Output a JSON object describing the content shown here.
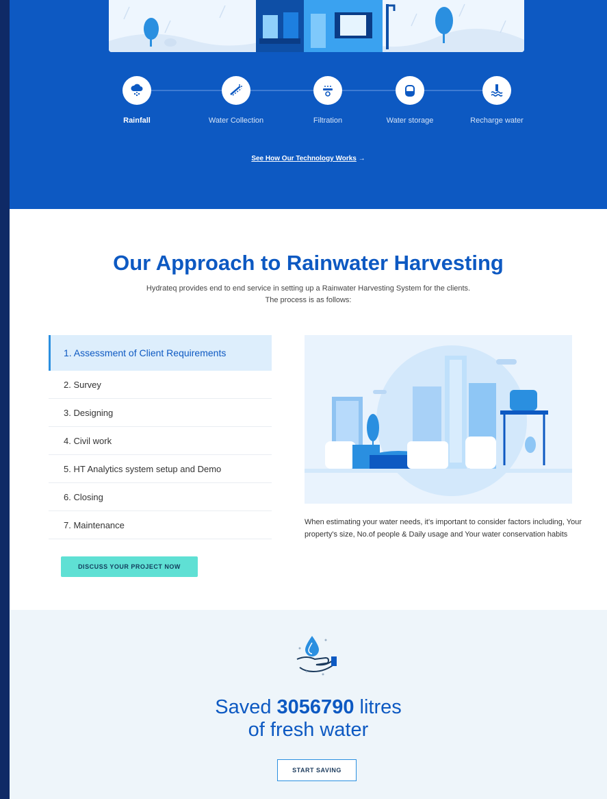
{
  "hero": {
    "steps": [
      {
        "label": "Rainfall",
        "icon": "cloud-rain-icon"
      },
      {
        "label": "Water Collection",
        "icon": "roof-icon"
      },
      {
        "label": "Filtration",
        "icon": "filter-icon"
      },
      {
        "label": "Water storage",
        "icon": "tank-icon"
      },
      {
        "label": "Recharge water",
        "icon": "recharge-icon"
      }
    ],
    "tech_link": "See How Our Technology Works",
    "tech_arrow": "→"
  },
  "approach": {
    "title": "Our Approach to Rainwater Harvesting",
    "subtitle": "Hydrateq provides end to end service in setting up a Rainwater Harvesting System for the clients.  The process is as follows:",
    "steps": [
      "1. Assessment of Client Requirements",
      "2. Survey",
      "3. Designing",
      "4. Civil work",
      "5. HT Analytics system setup and Demo",
      "6. Closing",
      "7. Maintenance"
    ],
    "discuss_button": "DISCUSS YOUR PROJECT NOW",
    "description": "When estimating your water needs, it's important to consider factors including, Your property's size, No.of people & Daily usage and Your water conservation habits"
  },
  "saved": {
    "prefix": "Saved ",
    "amount": "3056790",
    "suffix": " litres",
    "line2": "of fresh water",
    "button": "START SAVING"
  },
  "colors": {
    "brand_blue": "#0d59c2",
    "accent_teal": "#5fe0d4",
    "active_bg": "#ddeefc",
    "light_bg": "#eef5fa"
  }
}
